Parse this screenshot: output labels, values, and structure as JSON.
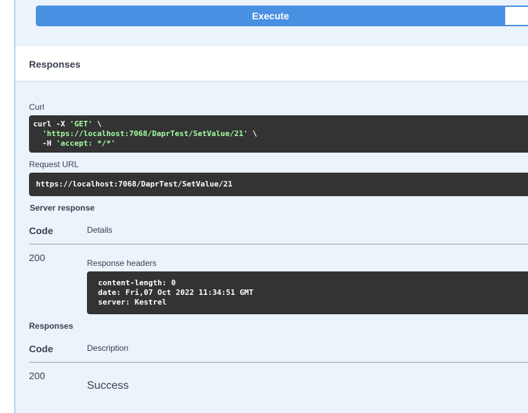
{
  "execute": {
    "label": "Execute"
  },
  "responses_section": {
    "title": "Responses"
  },
  "curl": {
    "label": "Curl",
    "line1_cmd": "curl -X ",
    "line1_method": "'GET'",
    "line1_tail": " \\",
    "line2_url": "'https://localhost:7068/DaprTest/SetValue/21'",
    "line2_tail": " \\",
    "line3_cmd": "  -H ",
    "line3_header": "'accept: */*'"
  },
  "request_url": {
    "label": "Request URL",
    "value": "https://localhost:7068/DaprTest/SetValue/21"
  },
  "server_response": {
    "label": "Server response",
    "col_code": "Code",
    "col_details": "Details",
    "status": "200",
    "headers_label": "Response headers",
    "headers": [
      "content-length: 0",
      "date: Fri,07 Oct 2022 11:34:51 GMT",
      "server: Kestrel"
    ]
  },
  "documented_responses": {
    "label": "Responses",
    "col_code": "Code",
    "col_description": "Description",
    "rows": [
      {
        "code": "200",
        "description": "Success"
      }
    ]
  },
  "colors": {
    "execute_bg": "#4990e2",
    "panel_bg": "#ebf3fb",
    "code_bg": "#333333",
    "string_green": "#a2fca2"
  }
}
